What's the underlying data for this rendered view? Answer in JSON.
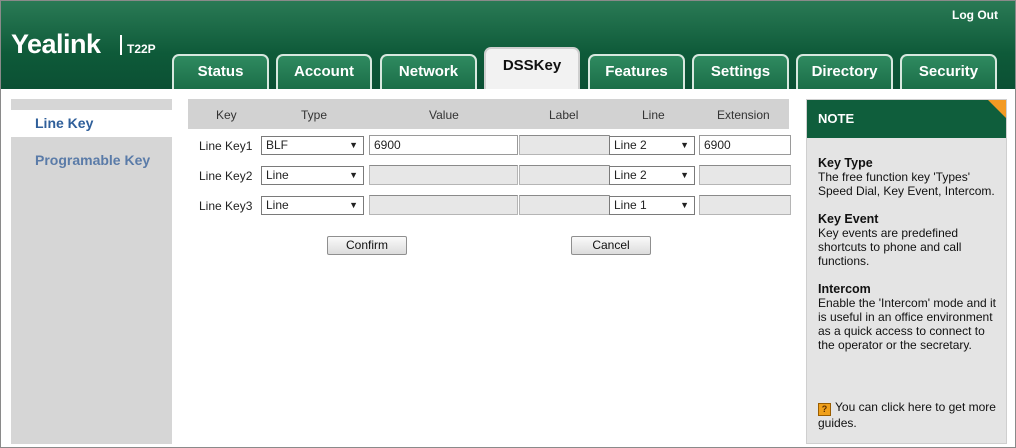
{
  "header": {
    "logo": "Yealink",
    "model": "T22P",
    "logout": "Log Out"
  },
  "tabs": [
    "Status",
    "Account",
    "Network",
    "DSSKey",
    "Features",
    "Settings",
    "Directory",
    "Security"
  ],
  "active_tab": "DSSKey",
  "sidebar": {
    "items": [
      {
        "label": "Line Key",
        "active": true
      },
      {
        "label": "Programable Key",
        "active": false
      }
    ]
  },
  "table": {
    "headers": {
      "key": "Key",
      "type": "Type",
      "value": "Value",
      "label": "Label",
      "line": "Line",
      "extension": "Extension"
    },
    "rows": [
      {
        "key": "Line Key1",
        "type": "BLF",
        "value": "6900",
        "label": "",
        "line": "Line 2",
        "extension": "6900"
      },
      {
        "key": "Line Key2",
        "type": "Line",
        "value": "",
        "label": "",
        "line": "Line 2",
        "extension": ""
      },
      {
        "key": "Line Key3",
        "type": "Line",
        "value": "",
        "label": "",
        "line": "Line 1",
        "extension": ""
      }
    ]
  },
  "buttons": {
    "confirm": "Confirm",
    "cancel": "Cancel"
  },
  "note": {
    "title": "NOTE",
    "sections": [
      {
        "title": "Key Type",
        "text": "The free function key 'Types' Speed Dial, Key Event, Intercom."
      },
      {
        "title": "Key Event",
        "text": "Key events are predefined shortcuts to phone and call functions."
      },
      {
        "title": "Intercom",
        "text": "Enable the 'Intercom' mode and it is useful in an office environment as a quick access to connect to the operator or the secretary."
      }
    ],
    "guide_icon": "?",
    "guide_text": "You can click here to get more guides."
  },
  "colors": {
    "header_green": "#0e5a39",
    "accent_orange": "#f39a23",
    "nav_text": "#5a7ba8"
  }
}
